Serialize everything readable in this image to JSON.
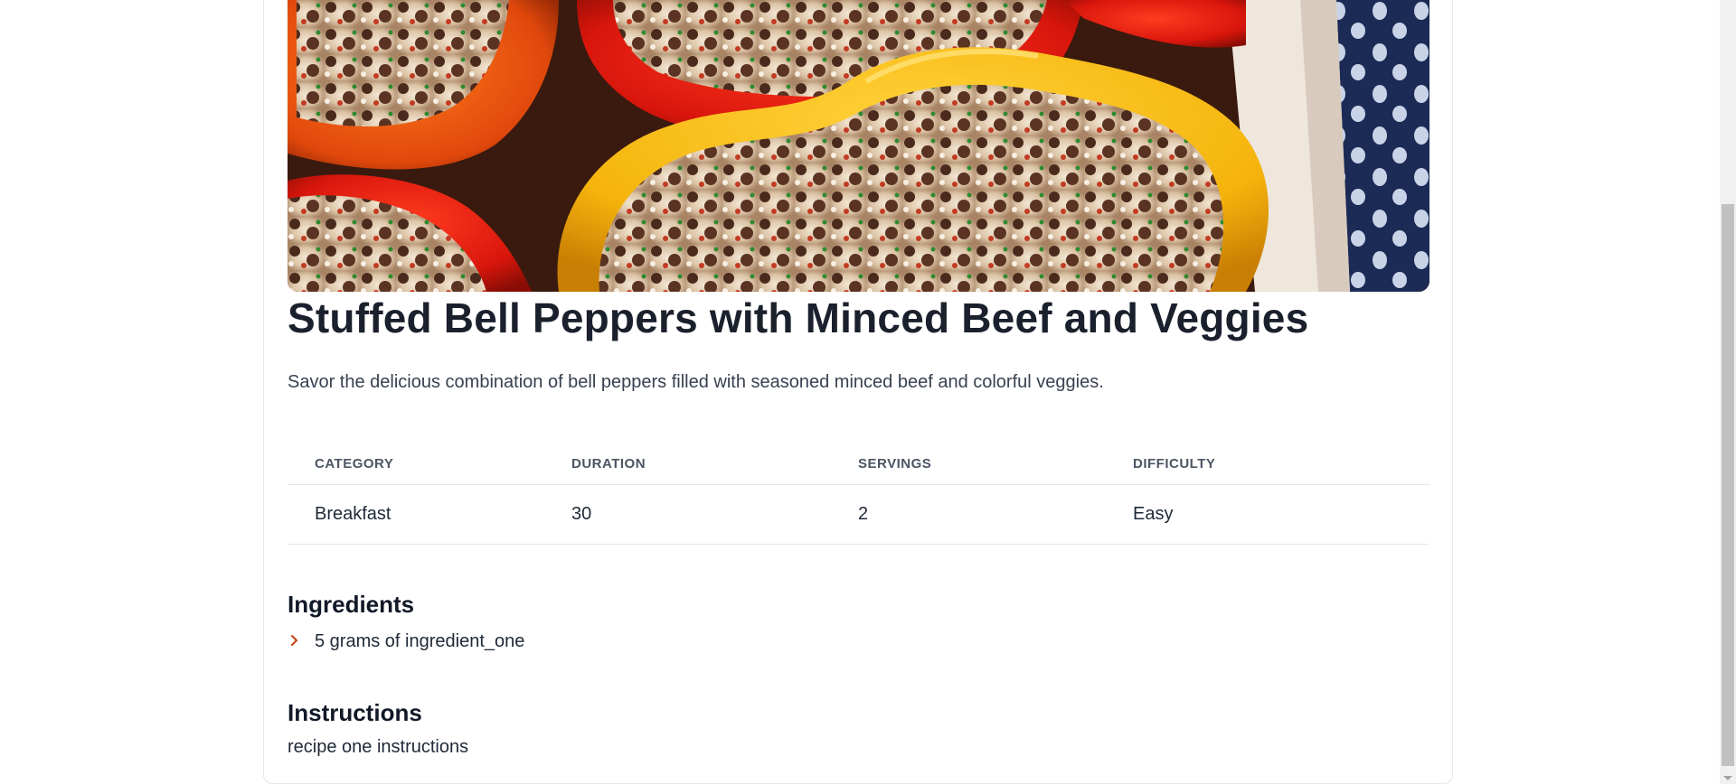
{
  "recipe": {
    "image_alt": "Stuffed bell peppers photo",
    "title": "Stuffed Bell Peppers with Minced Beef and Veggies",
    "description": "Savor the delicious combination of bell peppers filled with seasoned minced beef and colorful veggies."
  },
  "meta_table": {
    "headers": [
      "CATEGORY",
      "DURATION",
      "SERVINGS",
      "DIFFICULTY"
    ],
    "values": [
      "Breakfast",
      "30",
      "2",
      "Easy"
    ]
  },
  "ingredients": {
    "heading": "Ingredients",
    "items": [
      "5 grams of ingredient_one"
    ],
    "bullet_icon": "chevron-right-icon"
  },
  "instructions": {
    "heading": "Instructions",
    "text": "recipe one instructions"
  },
  "colors": {
    "accent": "#c2410c",
    "title": "#1a202c",
    "border": "#e5e7eb"
  }
}
